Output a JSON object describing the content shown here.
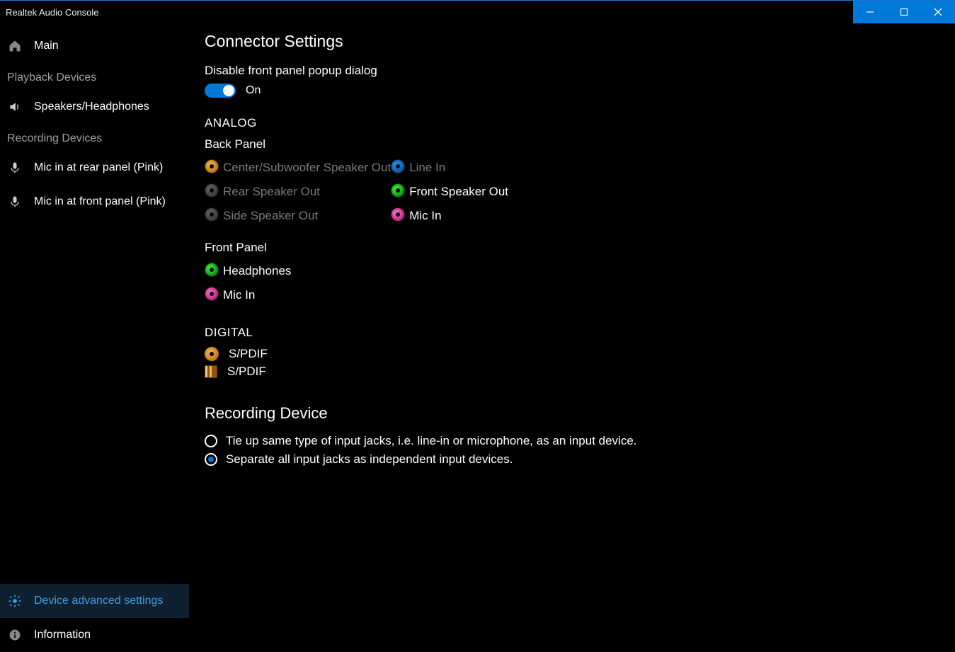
{
  "app_title": "Realtek Audio Console",
  "sidebar": {
    "main": "Main",
    "playback_section": "Playback Devices",
    "playback_items": [
      "Speakers/Headphones"
    ],
    "recording_section": "Recording Devices",
    "recording_items": [
      "Mic in at rear panel (Pink)",
      "Mic in at front panel (Pink)"
    ],
    "advanced": "Device advanced settings",
    "information": "Information"
  },
  "content": {
    "connector_settings": "Connector Settings",
    "disable_popup_label": "Disable front panel popup dialog",
    "toggle_state": "On",
    "analog_heading": "ANALOG",
    "back_panel": "Back Panel",
    "front_panel": "Front Panel",
    "jacks": {
      "center_sub": "Center/Subwoofer Speaker Out",
      "line_in": "Line In",
      "rear_out": "Rear Speaker Out",
      "front_out": "Front Speaker Out",
      "side_out": "Side Speaker Out",
      "mic_in": "Mic In",
      "headphones": "Headphones"
    },
    "digital_heading": "DIGITAL",
    "spdif": "S/PDIF",
    "recording_device": "Recording Device",
    "radio_tie": "Tie up same type of input jacks, i.e. line-in or microphone, as an input device.",
    "radio_separate": "Separate all input jacks as independent input devices."
  }
}
